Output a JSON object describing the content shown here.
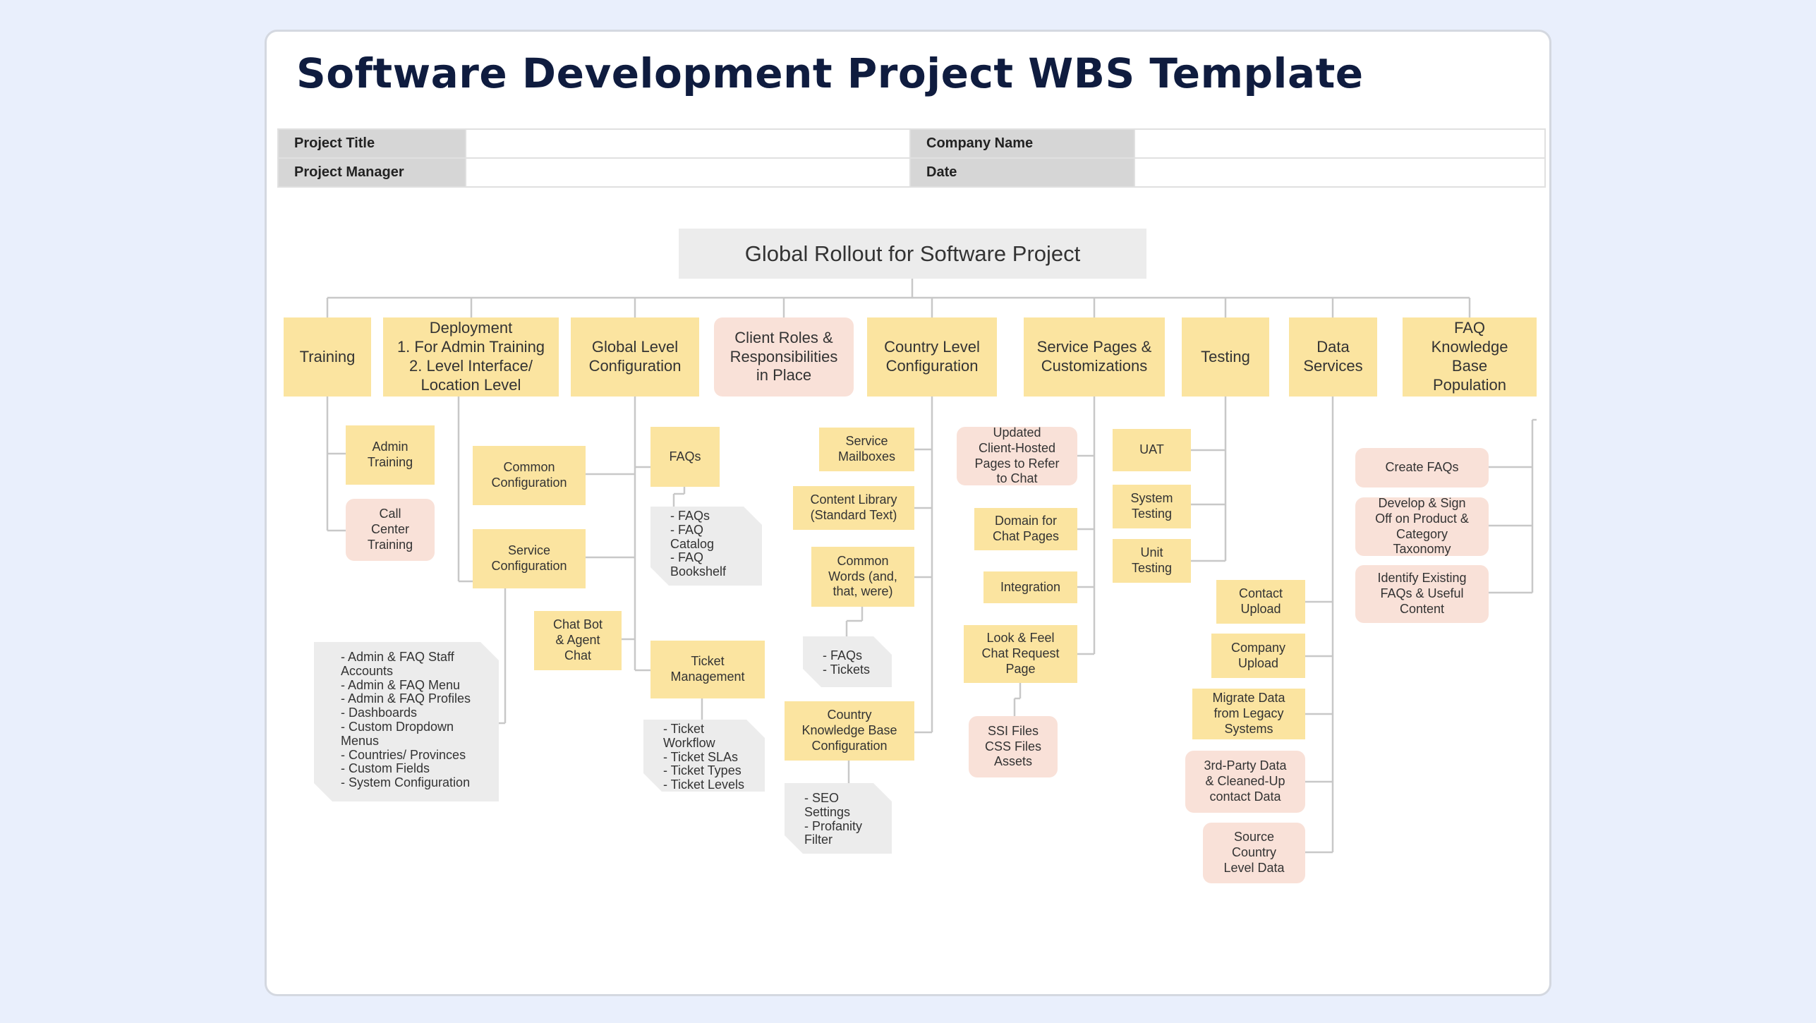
{
  "title": "Software Development Project WBS Template",
  "info": {
    "project_title": "Project Title",
    "company_name": "Company Name",
    "project_manager": "Project Manager",
    "date": "Date",
    "project_title_value": "",
    "company_name_value": "",
    "project_manager_value": "",
    "date_value": ""
  },
  "root": "Global Rollout for Software Project",
  "level1": {
    "training": "Training",
    "deployment": "Deployment\n1. For Admin Training\n2. Level Interface/\nLocation Level",
    "global_config": "Global Level\nConfiguration",
    "client_roles": "Client Roles &\nResponsibilities\nin Place",
    "country_config": "Country Level\nConfiguration",
    "service_pages": "Service Pages &\nCustomizations",
    "testing": "Testing",
    "data_services": "Data\nServices",
    "faq_kb": "FAQ\nKnowledge\nBase\nPopulation"
  },
  "training": {
    "admin": "Admin\nTraining",
    "call_center": "Call\nCenter\nTraining"
  },
  "deployment": {
    "notes": "- Admin & FAQ Staff\nAccounts\n- Admin & FAQ Menu\n- Admin & FAQ Profiles\n- Dashboards\n- Custom Dropdown\nMenus\n- Countries/ Provinces\n- Custom Fields\n- System Configuration"
  },
  "global_config": {
    "common": "Common\nConfiguration",
    "service": "Service\nConfiguration",
    "chatbot": "Chat Bot\n& Agent\nChat",
    "faqs": "FAQs",
    "faqs_notes": "- FAQs\n- FAQ\nCatalog\n- FAQ\nBookshelf",
    "ticket": "Ticket\nManagement",
    "ticket_notes": "- Ticket\nWorkflow\n- Ticket SLAs\n- Ticket Types\n- Ticket Levels"
  },
  "country_config": {
    "mailboxes": "Service\nMailboxes",
    "content_library": "Content Library\n(Standard Text)",
    "common_words": "Common\nWords (and,\nthat, were)",
    "common_words_notes": "- FAQs\n- Tickets",
    "country_kb": "Country\nKnowledge Base\nConfiguration",
    "country_kb_notes": "- SEO\nSettings\n- Profanity\nFilter"
  },
  "service_pages": {
    "updated": "Updated\nClient-Hosted\nPages to Refer\nto Chat",
    "domain": "Domain for\nChat Pages",
    "integration": "Integration",
    "look_feel": "Look & Feel\nChat Request\nPage",
    "ssi": "SSI Files\nCSS Files\nAssets"
  },
  "testing": {
    "uat": "UAT",
    "system": "System\nTesting",
    "unit": "Unit\nTesting"
  },
  "data_services": {
    "contact": "Contact\nUpload",
    "company": "Company\nUpload",
    "migrate": "Migrate Data\nfrom Legacy\nSystems",
    "third_party": "3rd-Party Data\n& Cleaned-Up\ncontact Data",
    "source": "Source\nCountry\nLevel Data"
  },
  "faq_kb": {
    "create": "Create FAQs",
    "develop": "Develop & Sign\nOff on Product &\nCategory\nTaxonomy",
    "identify": "Identify Existing\nFAQs & Useful\nContent"
  },
  "colors": {
    "background": "#e9effc",
    "title": "#0f1c3f",
    "yellow_box": "#fbe4a0",
    "pink_box": "#f9e1d8",
    "gray_box": "#ececec",
    "connector": "#c8c8c8"
  }
}
